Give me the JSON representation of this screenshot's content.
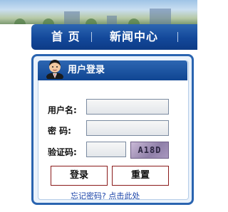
{
  "nav": {
    "items": [
      {
        "label": "首 页"
      },
      {
        "label": "新闻中心"
      }
    ]
  },
  "login": {
    "title": "用户登录",
    "username_label": "用户名:",
    "username_value": "",
    "password_label": "密  码:",
    "password_value": "",
    "captcha_label": "验证码:",
    "captcha_value": "",
    "captcha_text": "A18D",
    "login_button": "登录",
    "reset_button": "重置",
    "forgot_link": "忘记密码? 点击此处"
  },
  "colors": {
    "nav_blue": "#13489a",
    "panel_border": "#2a64b0",
    "button_border": "#8a1a1a",
    "link": "#1a43a8"
  },
  "icons": [
    "user-avatar-icon"
  ]
}
